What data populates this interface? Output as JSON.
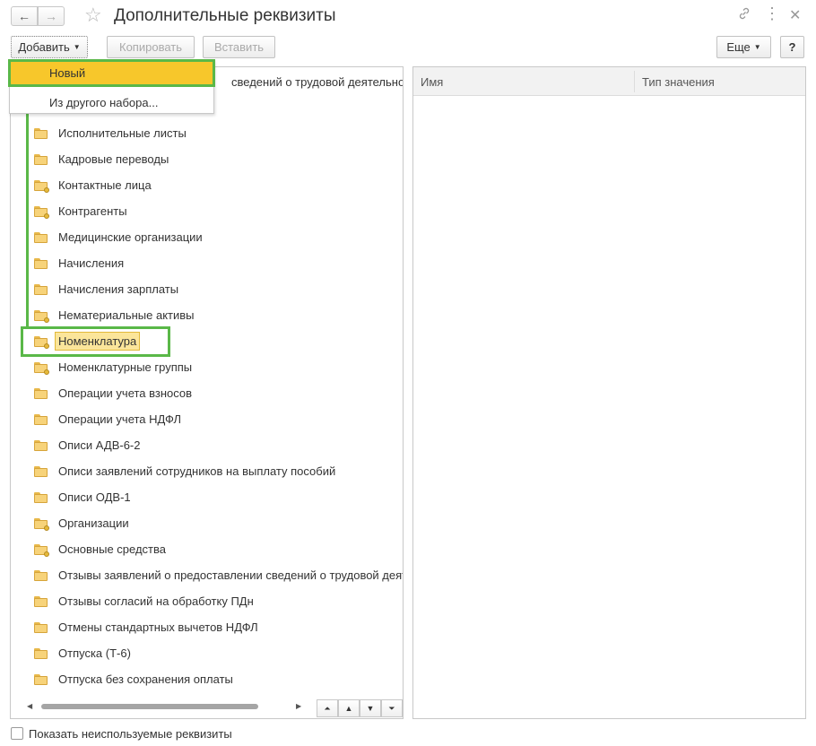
{
  "window": {
    "title": "Дополнительные реквизиты",
    "back_icon": "←",
    "forward_icon": "→",
    "star_icon": "☆",
    "link_icon": "🔗",
    "menu_icon": "⋮",
    "close_icon": "✕"
  },
  "toolbar": {
    "add_label": "Добавить",
    "copy_label": "Копировать",
    "paste_label": "Вставить",
    "more_label": "Еще",
    "help_label": "?"
  },
  "add_menu": {
    "items": [
      "Новый",
      "Из другого набора..."
    ]
  },
  "tree": {
    "truncated_top_item": "сведений о трудовой деятельност",
    "items": [
      {
        "label": "Исполнительные листы",
        "marked": false
      },
      {
        "label": "Кадровые переводы",
        "marked": false
      },
      {
        "label": "Контактные лица",
        "marked": true
      },
      {
        "label": "Контрагенты",
        "marked": true
      },
      {
        "label": "Медицинские организации",
        "marked": false
      },
      {
        "label": "Начисления",
        "marked": false
      },
      {
        "label": "Начисления зарплаты",
        "marked": false
      },
      {
        "label": "Нематериальные активы",
        "marked": true
      },
      {
        "label": "Номенклатура",
        "marked": true
      },
      {
        "label": "Номенклатурные группы",
        "marked": true
      },
      {
        "label": "Операции учета взносов",
        "marked": false
      },
      {
        "label": "Операции учета НДФЛ",
        "marked": false
      },
      {
        "label": "Описи АДВ-6-2",
        "marked": false
      },
      {
        "label": "Описи заявлений сотрудников на выплату пособий",
        "marked": false
      },
      {
        "label": "Описи ОДВ-1",
        "marked": false
      },
      {
        "label": "Организации",
        "marked": true
      },
      {
        "label": "Основные средства",
        "marked": true
      },
      {
        "label": "Отзывы заявлений о предоставлении сведений о трудовой деяте",
        "marked": false
      },
      {
        "label": "Отзывы согласий на обработку ПДн",
        "marked": false
      },
      {
        "label": "Отмены стандартных вычетов НДФЛ",
        "marked": false
      },
      {
        "label": "Отпуска (Т-6)",
        "marked": false
      },
      {
        "label": "Отпуска без сохранения оплаты",
        "marked": false
      }
    ],
    "selected_label": "Номенклатура"
  },
  "grid": {
    "columns": [
      "Имя",
      "Тип значения"
    ]
  },
  "footer": {
    "show_unused_label": "Показать неиспользуемые реквизиты",
    "show_unused_checked": false
  },
  "colors": {
    "highlight_green": "#5ab848",
    "menu_selected": "#f7c72b",
    "tree_selected": "#fbe59a"
  }
}
